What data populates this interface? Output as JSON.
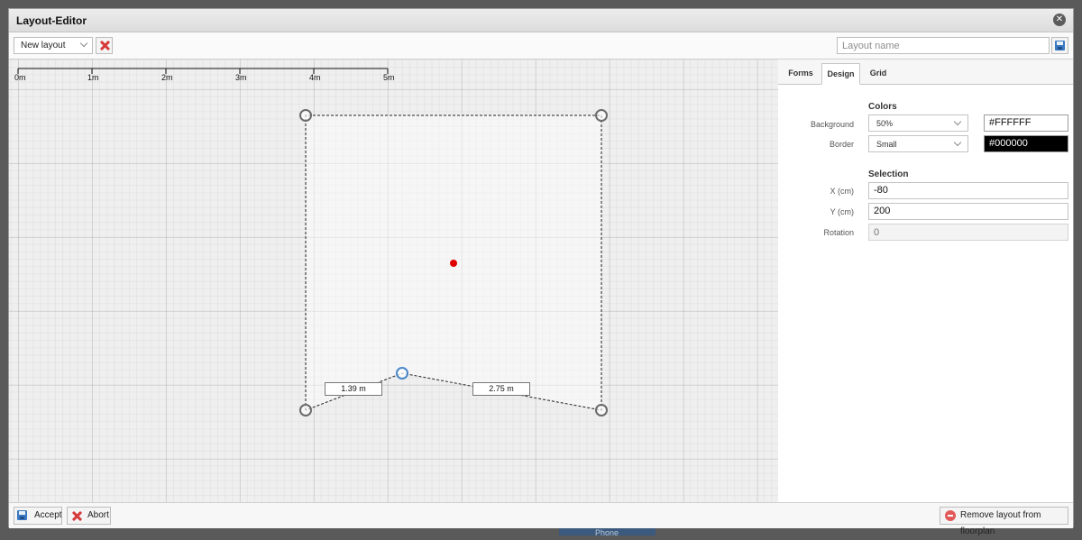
{
  "window": {
    "title": "Layout-Editor"
  },
  "toolbar": {
    "layout_select_value": "New layout",
    "layout_name_placeholder": "Layout name"
  },
  "canvas": {
    "ruler_labels": [
      "0m",
      "1m",
      "2m",
      "3m",
      "4m",
      "5m"
    ],
    "measurements": [
      "1.39 m",
      "2.75 m"
    ]
  },
  "panel": {
    "tabs": [
      {
        "label": "Forms",
        "active": false
      },
      {
        "label": "Design",
        "active": true
      },
      {
        "label": "Grid",
        "active": false
      }
    ],
    "colors": {
      "title": "Colors",
      "background_label": "Background",
      "background_value": "50%",
      "background_color": "#FFFFFF",
      "border_label": "Border",
      "border_value": "Small",
      "border_color": "#000000"
    },
    "selection": {
      "title": "Selection",
      "x_label": "X (cm)",
      "x_value": "-80",
      "y_label": "Y (cm)",
      "y_value": "200",
      "rotation_label": "Rotation",
      "rotation_placeholder": "0"
    }
  },
  "footer": {
    "accept_label": "Accept",
    "abort_label": "Abort",
    "remove_label": "Remove layout from floorplan"
  },
  "backdrop": {
    "text": "Phone"
  },
  "colors": {
    "accent_blue": "#3c79c2",
    "center_dot": "#e00000",
    "selected_handle": "#4a87c9",
    "delete_red": "#d63a3a"
  }
}
